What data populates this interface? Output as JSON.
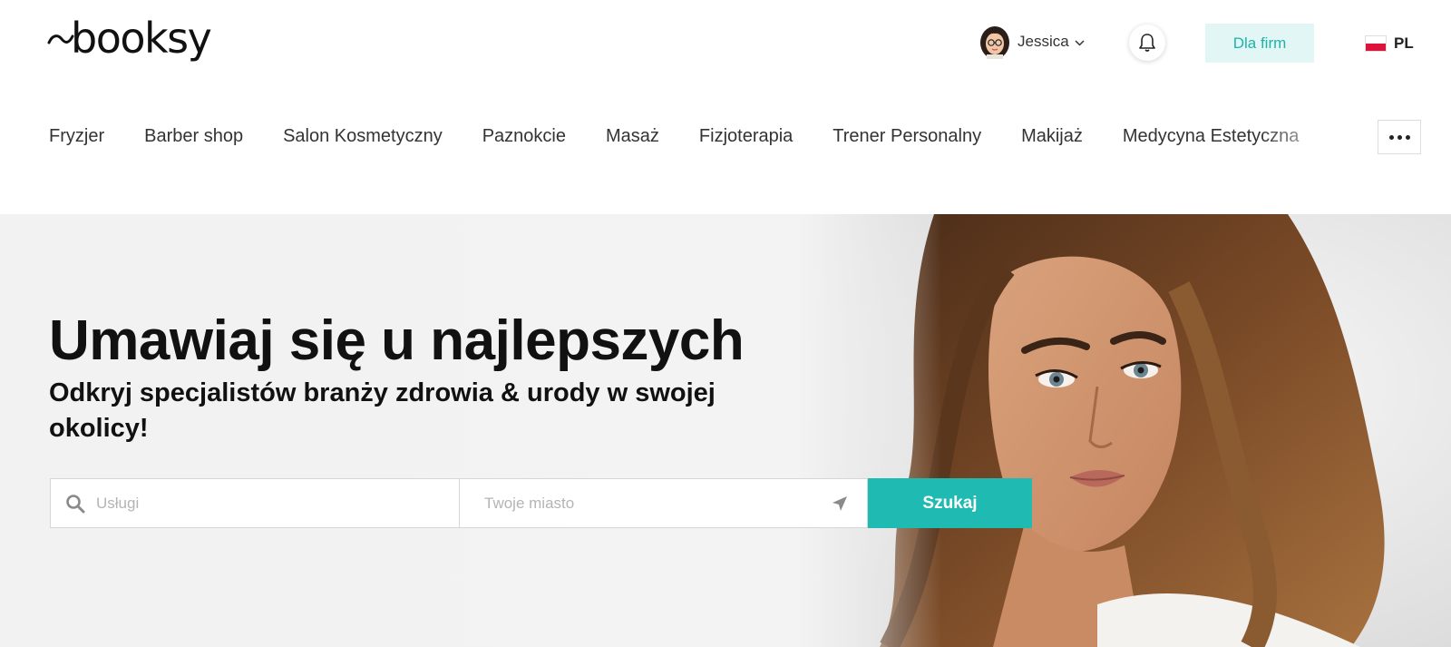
{
  "header": {
    "logo_text": "booksy",
    "user": {
      "name": "Jessica"
    },
    "business_button": "Dla firm",
    "language": "PL"
  },
  "categories": [
    "Fryzjer",
    "Barber shop",
    "Salon Kosmetyczny",
    "Paznokcie",
    "Masaż",
    "Fizjoterapia",
    "Trener Personalny",
    "Makijaż",
    "Medycyna Estetyczna"
  ],
  "hero": {
    "title": "Umawiaj się u najlepszych",
    "subtitle": "Odkryj specjalistów branży zdrowia & urody w swojej okolicy!",
    "search": {
      "service_placeholder": "Usługi",
      "city_placeholder": "Twoje miasto",
      "button": "Szukaj"
    }
  },
  "colors": {
    "accent": "#1fbab1",
    "business_button_bg": "#e2f6f5",
    "business_button_text": "#1eb3a9"
  },
  "icons": {
    "user_dropdown": "chevron-down-icon",
    "notifications": "bell-icon",
    "more": "more-horizontal-icon",
    "search": "search-icon",
    "location": "location-arrow-icon"
  }
}
